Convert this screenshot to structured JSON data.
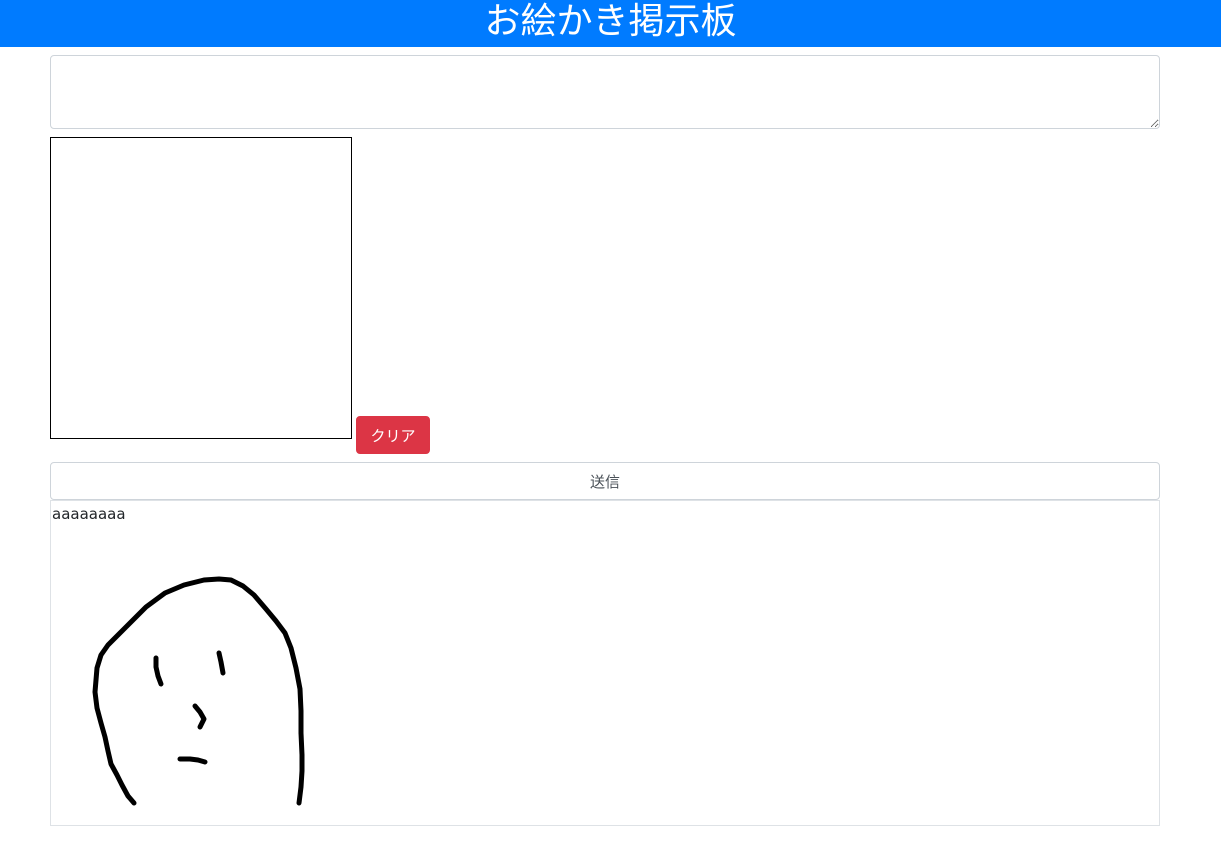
{
  "header": {
    "title": "お絵かき掲示板",
    "background_color": "#007bff"
  },
  "form": {
    "comment_value": "",
    "clear_label": "クリア",
    "clear_color": "#dc3545",
    "send_label": "送信"
  },
  "posts": [
    {
      "text": "aaaaaaaa",
      "drawing": "face-sketch"
    }
  ]
}
